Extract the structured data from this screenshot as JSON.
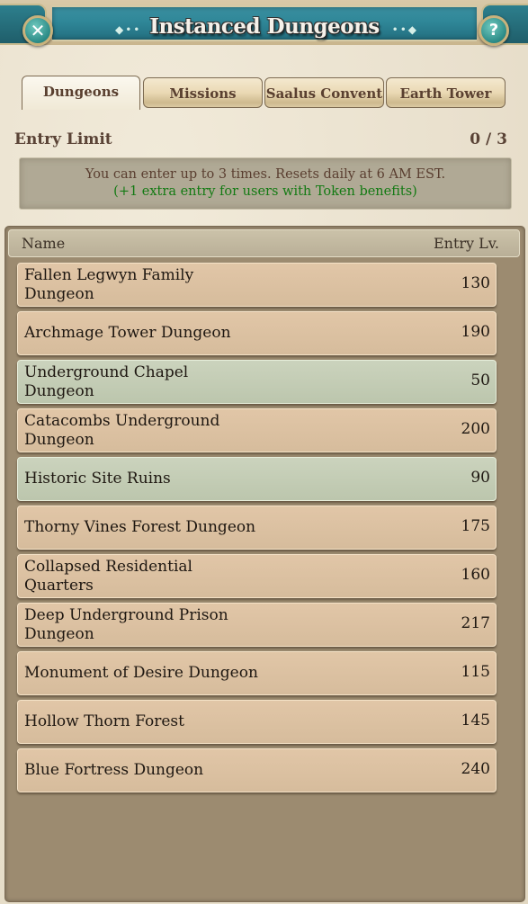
{
  "window": {
    "title": "Instanced Dungeons",
    "close_icon": "close-icon",
    "help_icon": "help-icon"
  },
  "tabs": [
    {
      "label": "Dungeons",
      "active": true
    },
    {
      "label": "Missions",
      "active": false
    },
    {
      "label": "Saalus Convent",
      "active": false
    },
    {
      "label": "Earth Tower",
      "active": false
    }
  ],
  "entry_limit": {
    "label": "Entry Limit",
    "value": "0 / 3"
  },
  "info": {
    "line1": "You can enter up to 3 times. Resets daily at 6 AM EST.",
    "line2": "(+1 extra entry for users with Token benefits)",
    "line2_color": "#137a13"
  },
  "list": {
    "header_name": "Name",
    "header_level": "Entry Lv.",
    "rows": [
      {
        "name": "Fallen Legwyn Family Dungeon",
        "level": "130",
        "highlight": false
      },
      {
        "name": "Archmage Tower Dungeon",
        "level": "190",
        "highlight": false
      },
      {
        "name": "Underground Chapel Dungeon",
        "level": "50",
        "highlight": true
      },
      {
        "name": "Catacombs Underground Dungeon",
        "level": "200",
        "highlight": false
      },
      {
        "name": "Historic Site Ruins",
        "level": "90",
        "highlight": true
      },
      {
        "name": "Thorny Vines Forest Dungeon",
        "level": "175",
        "highlight": false
      },
      {
        "name": "Collapsed Residential Quarters",
        "level": "160",
        "highlight": false
      },
      {
        "name": "Deep Underground Prison Dungeon",
        "level": "217",
        "highlight": false
      },
      {
        "name": "Monument of Desire Dungeon",
        "level": "115",
        "highlight": false
      },
      {
        "name": "Hollow Thorn Forest",
        "level": "145",
        "highlight": false
      },
      {
        "name": "Blue Fortress Dungeon",
        "level": "240",
        "highlight": false
      }
    ]
  }
}
